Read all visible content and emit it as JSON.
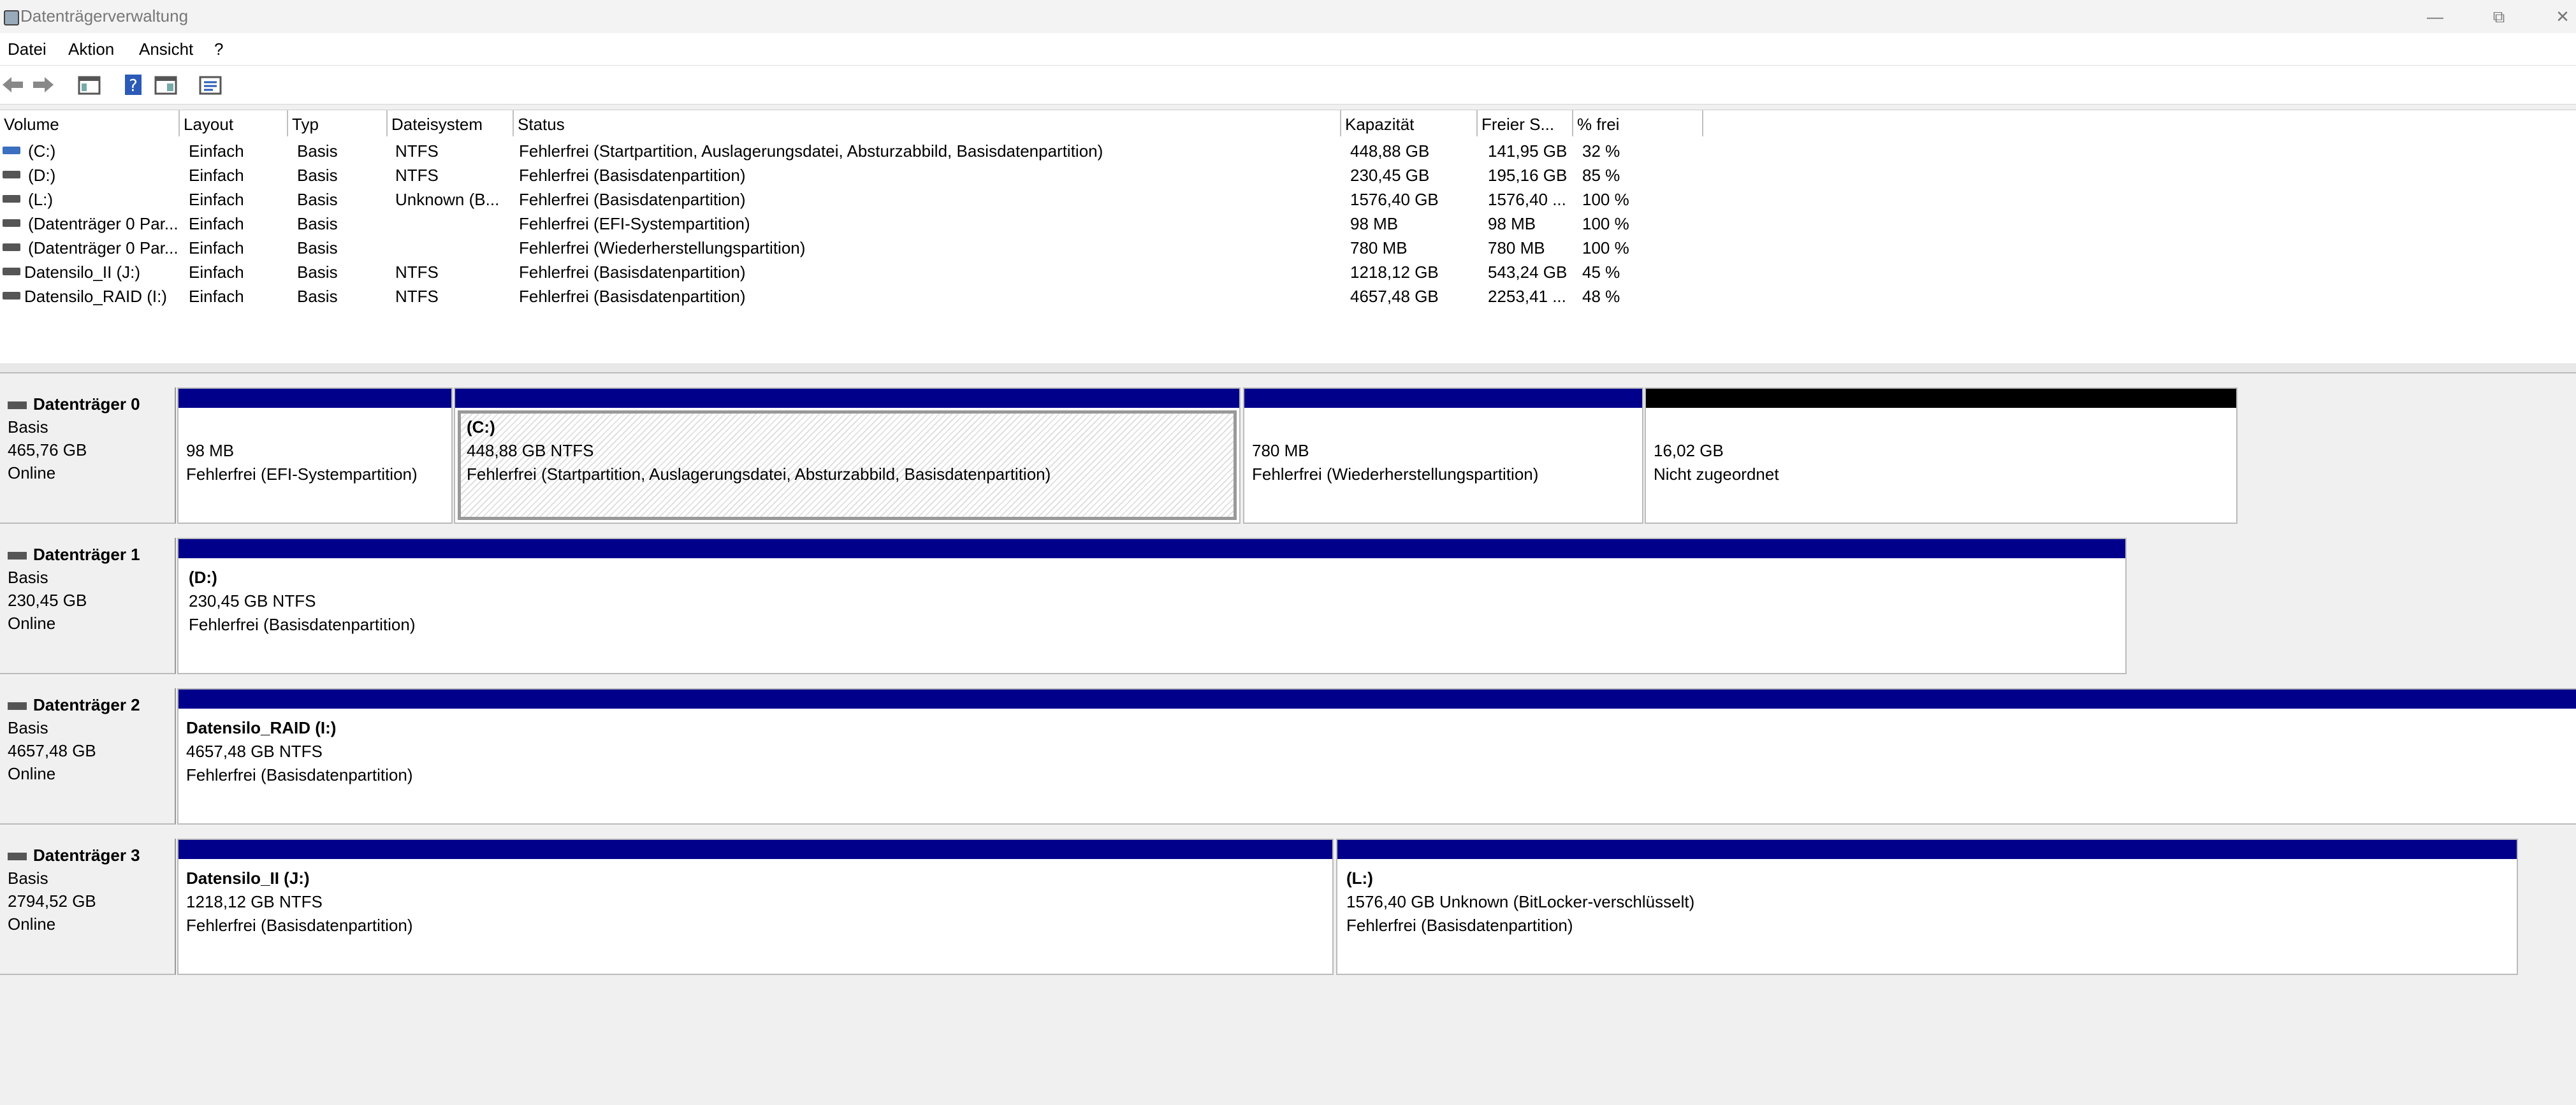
{
  "window": {
    "title": "Datenträgerverwaltung"
  },
  "menu": [
    "Datei",
    "Aktion",
    "Ansicht",
    "?"
  ],
  "toolbar_icons": [
    "back-arrow-icon",
    "forward-arrow-icon",
    "console-tree-icon",
    "help-icon",
    "action-pane-icon",
    "properties-icon"
  ],
  "columns": [
    "Volume",
    "Layout",
    "Typ",
    "Dateisystem",
    "Status",
    "Kapazität",
    "Freier S...",
    "% frei"
  ],
  "volumes": [
    {
      "volume": "(C:)",
      "layout": "Einfach",
      "typ": "Basis",
      "fs": "NTFS",
      "status": "Fehlerfrei (Startpartition, Auslagerungsdatei, Absturzabbild, Basisdatenpartition)",
      "cap": "448,88 GB",
      "free": "141,95 GB",
      "pct": "32 %"
    },
    {
      "volume": "(D:)",
      "layout": "Einfach",
      "typ": "Basis",
      "fs": "NTFS",
      "status": "Fehlerfrei (Basisdatenpartition)",
      "cap": "230,45 GB",
      "free": "195,16 GB",
      "pct": "85 %"
    },
    {
      "volume": "(L:)",
      "layout": "Einfach",
      "typ": "Basis",
      "fs": "Unknown (B...",
      "status": "Fehlerfrei (Basisdatenpartition)",
      "cap": "1576,40 GB",
      "free": "1576,40 ...",
      "pct": "100 %"
    },
    {
      "volume": "(Datenträger 0 Par...",
      "layout": "Einfach",
      "typ": "Basis",
      "fs": "",
      "status": "Fehlerfrei (EFI-Systempartition)",
      "cap": "98 MB",
      "free": "98 MB",
      "pct": "100 %"
    },
    {
      "volume": "(Datenträger 0 Par...",
      "layout": "Einfach",
      "typ": "Basis",
      "fs": "",
      "status": "Fehlerfrei (Wiederherstellungspartition)",
      "cap": "780 MB",
      "free": "780 MB",
      "pct": "100 %"
    },
    {
      "volume": "Datensilo_II (J:)",
      "layout": "Einfach",
      "typ": "Basis",
      "fs": "NTFS",
      "status": "Fehlerfrei (Basisdatenpartition)",
      "cap": "1218,12 GB",
      "free": "543,24 GB",
      "pct": "45 %"
    },
    {
      "volume": "Datensilo_RAID (I:)",
      "layout": "Einfach",
      "typ": "Basis",
      "fs": "NTFS",
      "status": "Fehlerfrei (Basisdatenpartition)",
      "cap": "4657,48 GB",
      "free": "2253,41 ...",
      "pct": "48 %"
    }
  ],
  "disks": [
    {
      "name": "Datenträger 0",
      "type": "Basis",
      "size": "465,76 GB",
      "state": "Online",
      "partitions": [
        {
          "name": "",
          "line1": "98 MB",
          "line2": "Fehlerfrei (EFI-Systempartition)"
        },
        {
          "name": "(C:)",
          "line1": "448,88 GB NTFS",
          "line2": "Fehlerfrei (Startpartition, Auslagerungsdatei, Absturzabbild, Basisdatenpartition)"
        },
        {
          "name": "",
          "line1": "780 MB",
          "line2": "Fehlerfrei (Wiederherstellungspartition)"
        },
        {
          "name": "",
          "line1": "16,02 GB",
          "line2": "Nicht zugeordnet"
        }
      ]
    },
    {
      "name": "Datenträger 1",
      "type": "Basis",
      "size": "230,45 GB",
      "state": "Online",
      "partitions": [
        {
          "name": "(D:)",
          "line1": "230,45 GB NTFS",
          "line2": "Fehlerfrei (Basisdatenpartition)"
        }
      ]
    },
    {
      "name": "Datenträger 2",
      "type": "Basis",
      "size": "4657,48 GB",
      "state": "Online",
      "partitions": [
        {
          "name": "Datensilo_RAID  (I:)",
          "line1": "4657,48 GB NTFS",
          "line2": "Fehlerfrei (Basisdatenpartition)"
        }
      ]
    },
    {
      "name": "Datenträger 3",
      "type": "Basis",
      "size": "2794,52 GB",
      "state": "Online",
      "partitions": [
        {
          "name": "Datensilo_II  (J:)",
          "line1": "1218,12 GB NTFS",
          "line2": "Fehlerfrei (Basisdatenpartition)"
        },
        {
          "name": "(L:)",
          "line1": "1576,40 GB Unknown (BitLocker-verschlüsselt)",
          "line2": "Fehlerfrei (Basisdatenpartition)"
        }
      ]
    }
  ],
  "colors": {
    "primary_partition": "#00008b",
    "unallocated": "#000000"
  }
}
